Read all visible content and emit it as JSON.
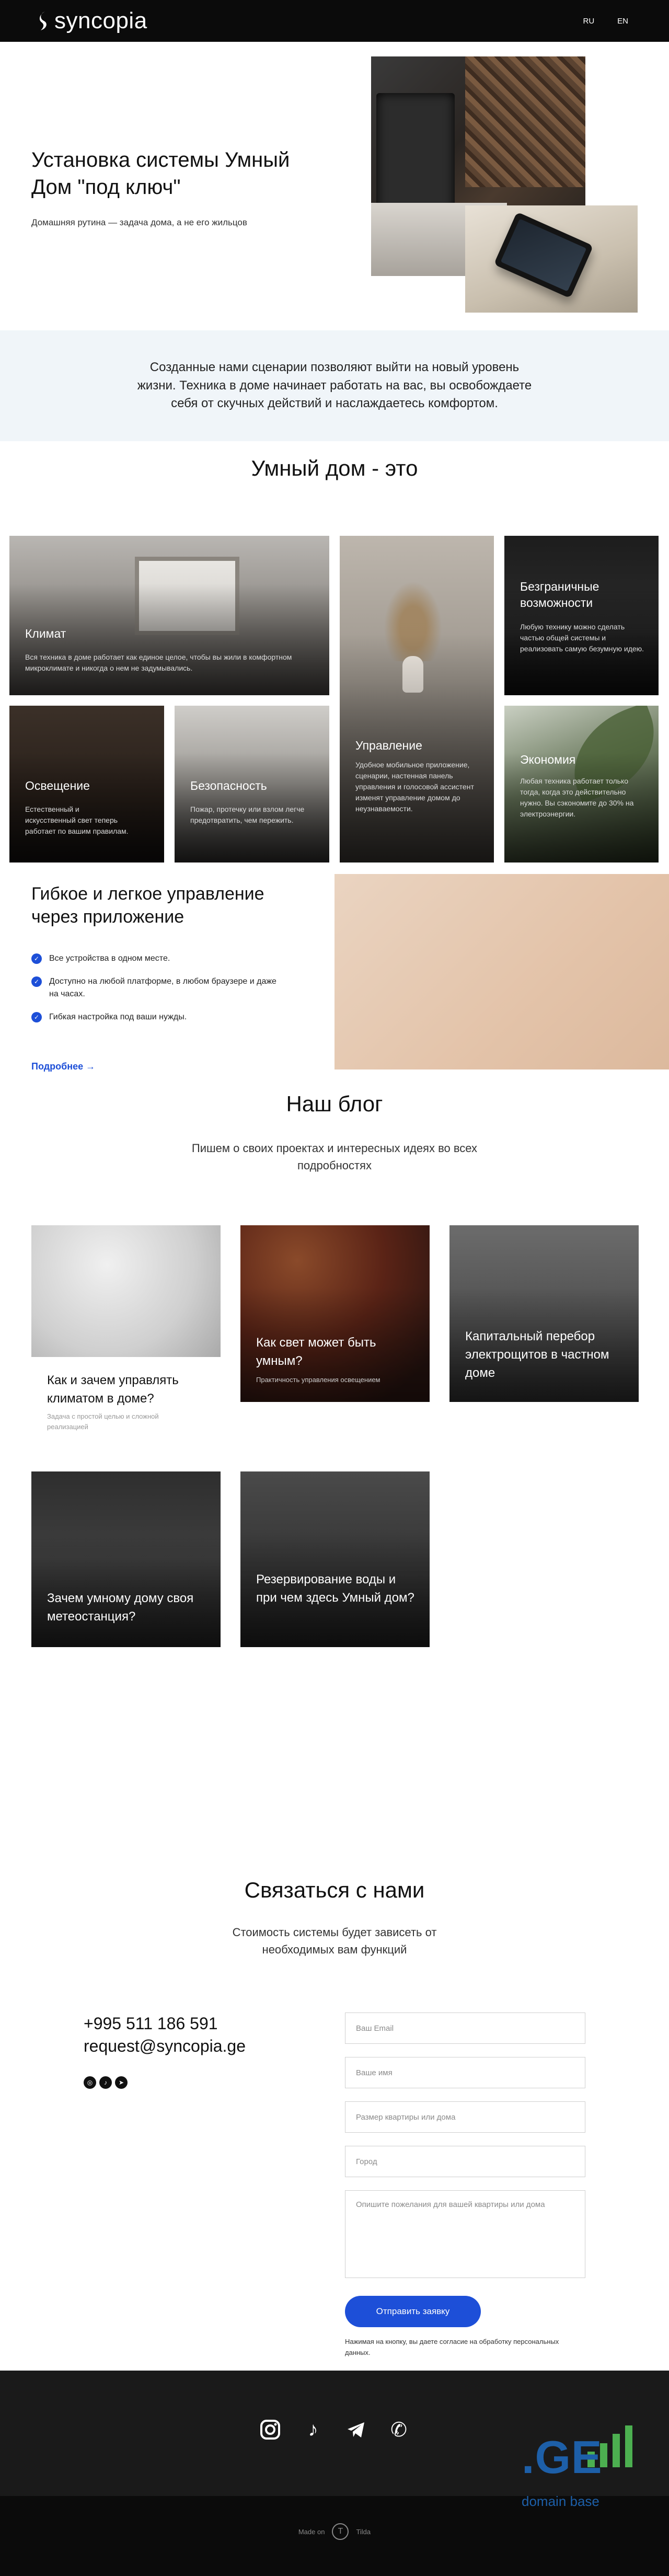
{
  "header": {
    "logo_text": "syncopia",
    "languages": [
      "RU",
      "EN"
    ]
  },
  "hero": {
    "title": "Установка системы Умный Дом \"под ключ\"",
    "subtitle": "Домашняя рутина — задача дома, а не его жильцов"
  },
  "intro": {
    "text": "Созданные нами сценарии позволяют выйти на новый уровень жизни. Техника в доме начинает работать на вас, вы освобождаете себя от скучных действий и наслаждаетесь комфортом."
  },
  "smart_home": {
    "title": "Умный дом - это",
    "cards": [
      {
        "title": "Климат",
        "text": "Вся техника в доме работает как единое целое, чтобы вы жили в комфортном микроклимате и никогда о нем не задумывались."
      },
      {
        "title": "Управление",
        "text": "Удобное мобильное приложение, сценарии, настенная панель управления и голосовой ассистент изменят управление домом до неузнаваемости."
      },
      {
        "title": "Безграничные возможности",
        "text": "Любую технику можно сделать частью общей системы и реализовать самую безумную идею."
      },
      {
        "title": "Освещение",
        "text": "Естественный и искусственный свет теперь работает по вашим правилам."
      },
      {
        "title": "Безопасность",
        "text": "Пожар, протечку или взлом легче предотвратить, чем пережить."
      },
      {
        "title": "Экономия",
        "text": "Любая техника работает только тогда, когда это действительно нужно. Вы сэкономите до 30% на электроэнергии."
      }
    ]
  },
  "flexible": {
    "title": "Гибкое и легкое управление через приложение",
    "features": [
      "Все устройства в одном месте.",
      "Доступно на любой платформе, в любом браузере и даже на часах.",
      "Гибкая настройка под ваши нужды."
    ],
    "more_link": "Подробнее →"
  },
  "blog": {
    "title": "Наш блог",
    "subtitle": "Пишем о своих проектах и интересных идеях во всех подробностях",
    "posts": [
      {
        "title": "Как и зачем управлять климатом в доме?",
        "meta": "Задача с простой целью и сложной реализацией"
      },
      {
        "title": "Как свет может быть умным?",
        "meta": "Практичность управления освещением"
      },
      {
        "title": "Капитальный перебор электрощитов в частном доме",
        "meta": ""
      },
      {
        "title": "Зачем умному дому своя метеостанция?",
        "meta": ""
      },
      {
        "title": "Резервирование воды и при чем здесь Умный дом?",
        "meta": ""
      }
    ]
  },
  "contact": {
    "title": "Связаться с нами",
    "subtitle": "Стоимость системы будет зависеть от необходимых вам функций",
    "phone": "+995 511 186 591",
    "email": "request@syncopia.ge",
    "form": {
      "email_placeholder": "Ваш Email",
      "name_placeholder": "Ваше имя",
      "size_placeholder": "Размер квартиры или дома",
      "city_placeholder": "Город",
      "wishes_placeholder": "Опишите пожелания для вашей квартиры или дома",
      "submit_label": "Отправить заявку",
      "consent_text": "Нажимая на кнопку, вы даете согласие на обработку персональных данных."
    }
  },
  "footer": {
    "made_in": "Made on",
    "tilda": "Tilda",
    "domain_badge": ".GE",
    "domain_badge_sub": "domain base"
  },
  "colors": {
    "accent": "#1d4fd8",
    "header_bg": "#0b0b0b",
    "intro_bg": "#f0f5f9",
    "footer_bg": "#1a1a1a"
  },
  "icons": {
    "check": "check-icon",
    "instagram": "instagram-icon",
    "tiktok": "tiktok-icon",
    "telegram": "telegram-icon",
    "phone": "phone-icon"
  }
}
